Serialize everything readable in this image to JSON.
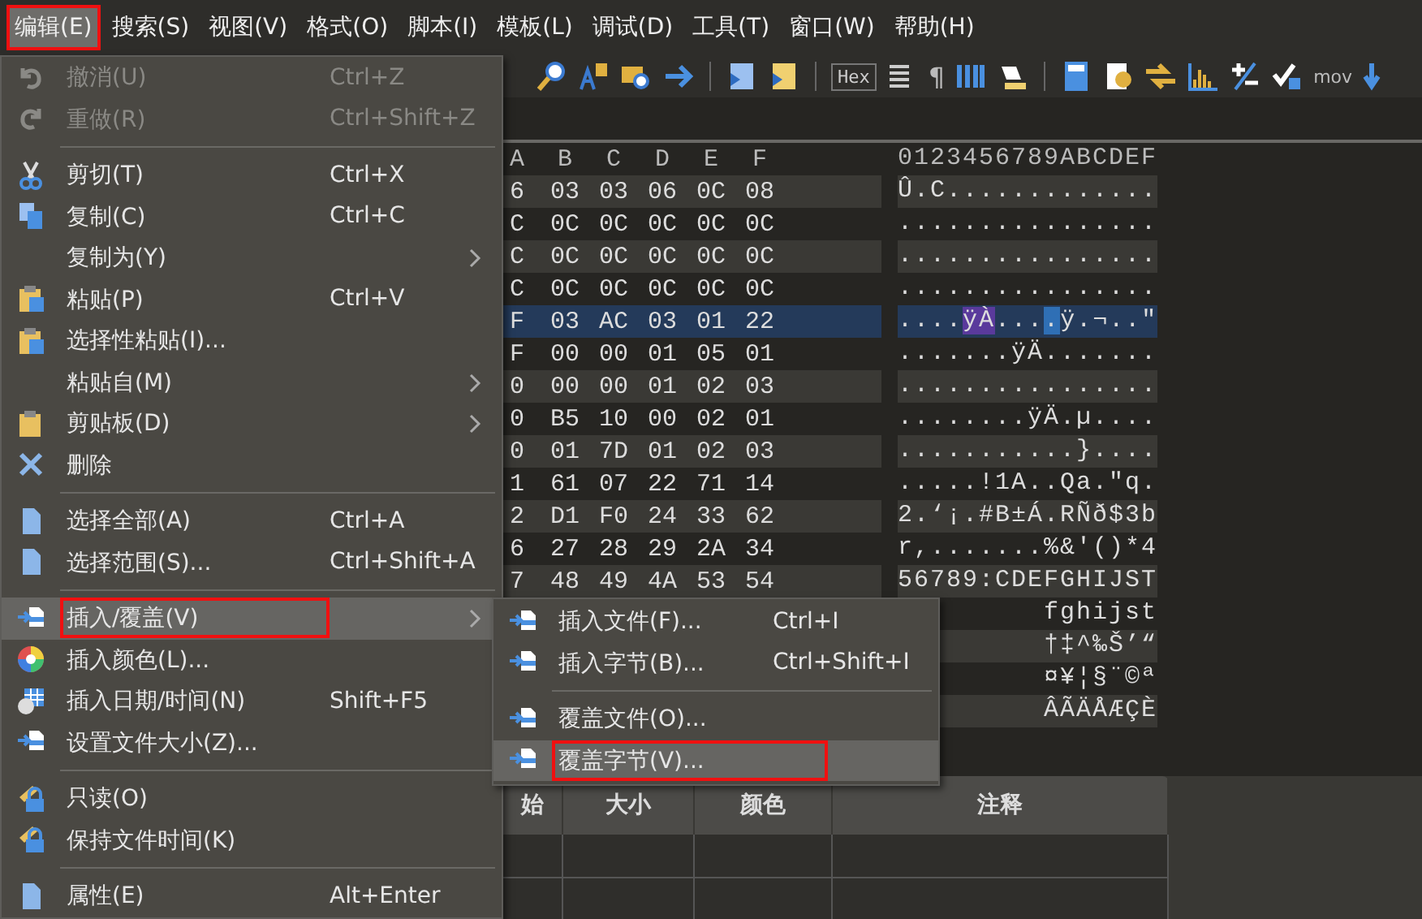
{
  "menubar": [
    {
      "label": "编辑(E)",
      "selected": true,
      "marked": true
    },
    {
      "label": "搜索(S)",
      "selected": false,
      "marked": false
    },
    {
      "label": "视图(V)",
      "selected": false,
      "marked": false
    },
    {
      "label": "格式(O)",
      "selected": false,
      "marked": false
    },
    {
      "label": "脚本(I)",
      "selected": false,
      "marked": false
    },
    {
      "label": "模板(L)",
      "selected": false,
      "marked": false
    },
    {
      "label": "调试(D)",
      "selected": false,
      "marked": false
    },
    {
      "label": "工具(T)",
      "selected": false,
      "marked": false
    },
    {
      "label": "窗口(W)",
      "selected": false,
      "marked": false
    },
    {
      "label": "帮助(H)",
      "selected": false,
      "marked": false
    }
  ],
  "toolbar": {
    "labels": [
      "Hex",
      "¶",
      "mov"
    ]
  },
  "hex_view": {
    "columns": [
      "A",
      "B",
      "C",
      "D",
      "E",
      "F"
    ],
    "text_header": "0123456789ABCDEF",
    "rows": [
      {
        "hex": [
          "6",
          "03",
          "03",
          "06",
          "0C",
          "08"
        ],
        "text": "Û.C.............",
        "selected": false
      },
      {
        "hex": [
          "C",
          "0C",
          "0C",
          "0C",
          "0C",
          "0C"
        ],
        "text": "................",
        "selected": false
      },
      {
        "hex": [
          "C",
          "0C",
          "0C",
          "0C",
          "0C",
          "0C"
        ],
        "text": "................",
        "selected": false
      },
      {
        "hex": [
          "C",
          "0C",
          "0C",
          "0C",
          "0C",
          "0C"
        ],
        "text": "................",
        "selected": false
      },
      {
        "hex": [
          "F",
          "03",
          "AC",
          "03",
          "01",
          "22"
        ],
        "segments": [
          {
            "text": "...."
          },
          {
            "text": "ÿÀ",
            "color": "#5a3a9c"
          },
          {
            "text": "..."
          },
          {
            "text": ".",
            "color": "#2f6fb5"
          },
          {
            "text": "ÿ.¬..\""
          }
        ],
        "selected": true
      },
      {
        "hex": [
          "F",
          "00",
          "00",
          "01",
          "05",
          "01"
        ],
        "text": ".......ÿÄ.......",
        "selected": false
      },
      {
        "hex": [
          "0",
          "00",
          "00",
          "01",
          "02",
          "03"
        ],
        "text": "................",
        "selected": false
      },
      {
        "hex": [
          "0",
          "B5",
          "10",
          "00",
          "02",
          "01"
        ],
        "text": "........ÿÄ.µ....",
        "selected": false
      },
      {
        "hex": [
          "0",
          "01",
          "7D",
          "01",
          "02",
          "03"
        ],
        "text": "...........}....",
        "selected": false
      },
      {
        "hex": [
          "1",
          "61",
          "07",
          "22",
          "71",
          "14"
        ],
        "text": ".....!1A..Qa.\"q.",
        "selected": false
      },
      {
        "hex": [
          "2",
          "D1",
          "F0",
          "24",
          "33",
          "62"
        ],
        "text": "2.‘¡.#B±Á.RÑð$3b",
        "selected": false
      },
      {
        "hex": [
          "6",
          "27",
          "28",
          "29",
          "2A",
          "34"
        ],
        "text": "r,.......%&'()*4",
        "selected": false
      },
      {
        "hex": [
          "7",
          "48",
          "49",
          "4A",
          "53",
          "54"
        ],
        "text": "56789:CDEFGHIJST",
        "selected": false
      },
      {
        "text": "fghijst",
        "selected": false
      },
      {
        "text": "†‡^‰Š’“",
        "selected": false
      },
      {
        "text": "¤¥¦§¨©ª",
        "selected": false
      },
      {
        "text": "ÂÃÄÅÆÇÈ",
        "selected": false
      }
    ]
  },
  "bottom_table": {
    "columns": [
      "始",
      "大小",
      "颜色",
      "注释"
    ]
  },
  "edit_menu": [
    {
      "kind": "item",
      "label": "撤消(U)",
      "shortcut": "Ctrl+Z",
      "disabled": true,
      "selected": false,
      "marked": false,
      "submenu": false
    },
    {
      "kind": "item",
      "label": "重做(R)",
      "shortcut": "Ctrl+Shift+Z",
      "disabled": true,
      "selected": false,
      "marked": false,
      "submenu": false
    },
    {
      "kind": "separator"
    },
    {
      "kind": "item",
      "label": "剪切(T)",
      "shortcut": "Ctrl+X",
      "disabled": false,
      "selected": false,
      "marked": false,
      "submenu": false
    },
    {
      "kind": "item",
      "label": "复制(C)",
      "shortcut": "Ctrl+C",
      "disabled": false,
      "selected": false,
      "marked": false,
      "submenu": false
    },
    {
      "kind": "item",
      "label": "复制为(Y)",
      "disabled": false,
      "selected": false,
      "marked": false,
      "submenu": true
    },
    {
      "kind": "item",
      "label": "粘贴(P)",
      "shortcut": "Ctrl+V",
      "disabled": false,
      "selected": false,
      "marked": false,
      "submenu": false
    },
    {
      "kind": "item",
      "label": "选择性粘贴(I)...",
      "disabled": false,
      "selected": false,
      "marked": false,
      "submenu": false
    },
    {
      "kind": "item",
      "label": "粘贴自(M)",
      "disabled": false,
      "selected": false,
      "marked": false,
      "submenu": true
    },
    {
      "kind": "item",
      "label": "剪贴板(D)",
      "disabled": false,
      "selected": false,
      "marked": false,
      "submenu": true
    },
    {
      "kind": "item",
      "label": "删除",
      "disabled": false,
      "selected": false,
      "marked": false,
      "submenu": false
    },
    {
      "kind": "separator"
    },
    {
      "kind": "item",
      "label": "选择全部(A)",
      "shortcut": "Ctrl+A",
      "disabled": false,
      "selected": false,
      "marked": false,
      "submenu": false
    },
    {
      "kind": "item",
      "label": "选择范围(S)...",
      "shortcut": "Ctrl+Shift+A",
      "disabled": false,
      "selected": false,
      "marked": false,
      "submenu": false
    },
    {
      "kind": "separator"
    },
    {
      "kind": "item",
      "label": "插入/覆盖(V)",
      "disabled": false,
      "selected": true,
      "marked": true,
      "submenu": true
    },
    {
      "kind": "item",
      "label": "插入颜色(L)...",
      "disabled": false,
      "selected": false,
      "marked": false,
      "submenu": false
    },
    {
      "kind": "item",
      "label": "插入日期/时间(N)",
      "shortcut": "Shift+F5",
      "disabled": false,
      "selected": false,
      "marked": false,
      "submenu": false
    },
    {
      "kind": "item",
      "label": "设置文件大小(Z)...",
      "disabled": false,
      "selected": false,
      "marked": false,
      "submenu": false
    },
    {
      "kind": "separator"
    },
    {
      "kind": "item",
      "label": "只读(O)",
      "disabled": false,
      "selected": false,
      "marked": false,
      "submenu": false
    },
    {
      "kind": "item",
      "label": "保持文件时间(K)",
      "disabled": false,
      "selected": false,
      "marked": false,
      "submenu": false
    },
    {
      "kind": "separator"
    },
    {
      "kind": "item",
      "label": "属性(E)",
      "shortcut": "Alt+Enter",
      "disabled": false,
      "selected": false,
      "marked": false,
      "submenu": false
    }
  ],
  "insert_submenu": [
    {
      "kind": "item",
      "label": "插入文件(F)...",
      "shortcut": "Ctrl+I",
      "disabled": false,
      "selected": false,
      "marked": false,
      "submenu": false
    },
    {
      "kind": "item",
      "label": "插入字节(B)...",
      "shortcut": "Ctrl+Shift+I",
      "disabled": false,
      "selected": false,
      "marked": false,
      "submenu": false
    },
    {
      "kind": "separator"
    },
    {
      "kind": "item",
      "label": "覆盖文件(O)...",
      "disabled": false,
      "selected": false,
      "marked": false,
      "submenu": false
    },
    {
      "kind": "item",
      "label": "覆盖字节(V)...",
      "disabled": false,
      "selected": true,
      "marked": true,
      "submenu": false
    }
  ]
}
